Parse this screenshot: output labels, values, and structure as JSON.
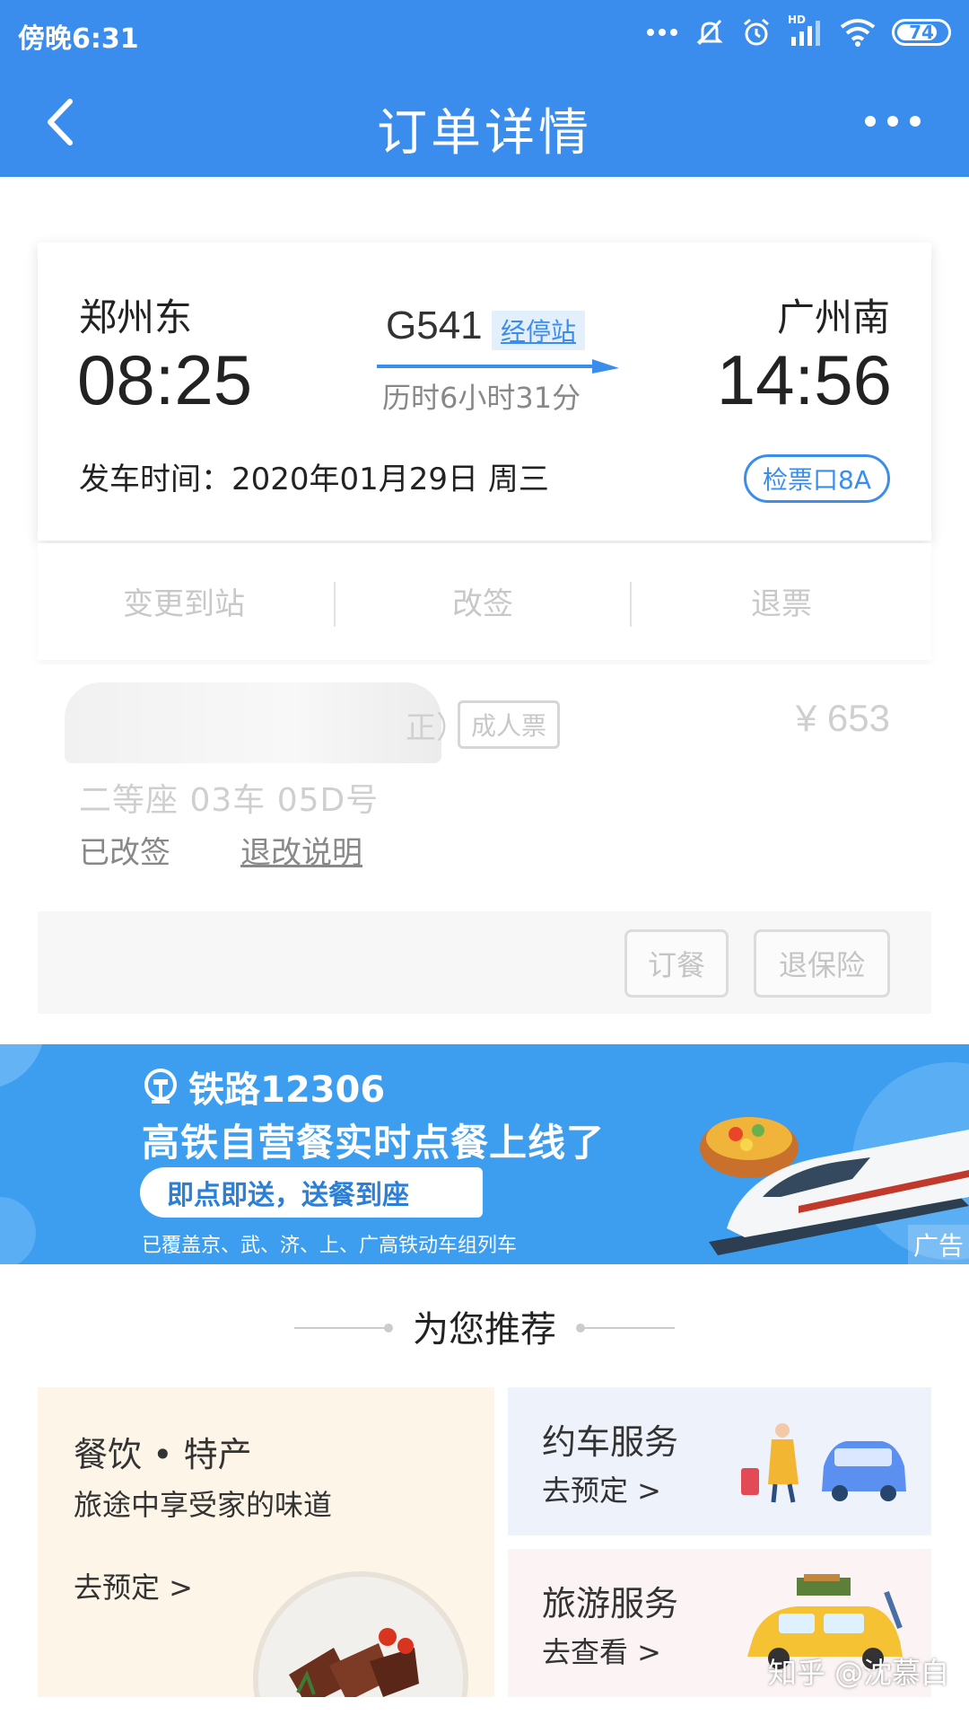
{
  "status_bar": {
    "time": "傍晚6:31",
    "battery": "74",
    "network": "HD"
  },
  "header": {
    "title": "订单详情"
  },
  "ticket": {
    "from_station": "郑州东",
    "from_time": "08:25",
    "to_station": "广州南",
    "to_time": "14:56",
    "train_no": "G541",
    "stops_link": "经停站",
    "duration": "历时6小时31分",
    "depart_label": "发车时间：",
    "depart_date": "2020年01月29日 周三",
    "gate": "检票口8A"
  },
  "actions": {
    "change_destination": "变更到站",
    "rebook": "改签",
    "refund": "退票"
  },
  "passenger": {
    "name_tail": "正）",
    "ticket_type": "成人票",
    "price": "¥ 653",
    "seat": "二等座 03车 05D号",
    "status": "已改签",
    "rules_link": "退改说明",
    "buttons": {
      "meal": "订餐",
      "insurance_refund": "退保险"
    }
  },
  "banner": {
    "brand": "铁路12306",
    "headline": "高铁自营餐实时点餐上线了",
    "pill": "即点即送，送餐到座",
    "coverage": "已覆盖京、武、济、上、广高铁动车组列车",
    "ad_tag": "广告"
  },
  "recommend": {
    "title": "为您推荐",
    "food": {
      "title": "餐饮 • 特产",
      "subtitle": "旅途中享受家的味道",
      "cta": "去预定 >"
    },
    "car": {
      "title": "约车服务",
      "cta": "去预定 >"
    },
    "tour": {
      "title": "旅游服务",
      "cta": "去查看 >"
    }
  },
  "watermark": "知乎 @沈慕白",
  "colors": {
    "primary": "#3b8ded",
    "banner": "#3d9ef0",
    "food_tile": "#fdf5e8",
    "car_tile": "#eef2fb",
    "tour_tile": "#fbf3f4"
  },
  "icons": [
    "back-arrow-icon",
    "more-icon",
    "signal-icon",
    "wifi-icon",
    "alarm-icon",
    "mute-icon",
    "battery-icon",
    "railway-logo-icon",
    "chevron-right-icon"
  ]
}
